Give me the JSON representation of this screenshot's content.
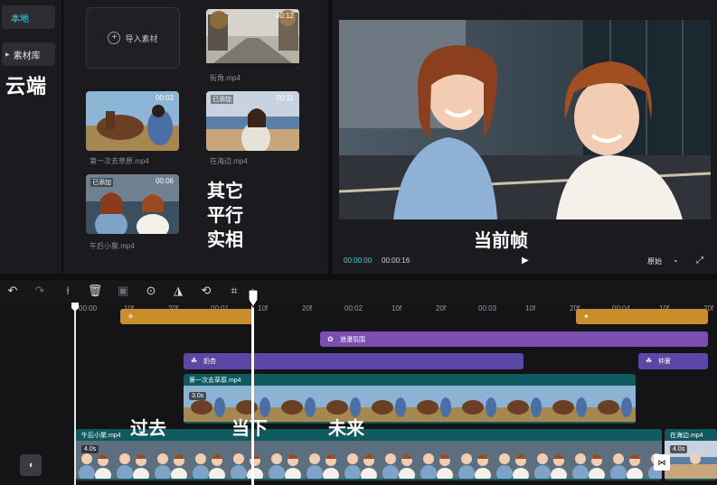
{
  "sidebar": {
    "local_label": "本地",
    "library_label": "素材库",
    "annotation_cloud": "云端"
  },
  "media": {
    "import_label": "导入素材",
    "items": [
      {
        "caption": "街角.mp4",
        "duration": "00:12",
        "badge": ""
      },
      {
        "caption": "第一次去草原.mp4",
        "duration": "00:03",
        "badge": ""
      },
      {
        "caption": "在海边.mp4",
        "duration": "00:11",
        "badge": "已添加"
      },
      {
        "caption": "午后小聚.mp4",
        "duration": "00:06",
        "badge": "已添加"
      }
    ],
    "annotation_lines": [
      "其它",
      "平行",
      "实相"
    ]
  },
  "player": {
    "annotation": "当前帧",
    "current_time": "00:00:00",
    "total_time": "00:00:16",
    "ratio_label": "原始"
  },
  "timeline": {
    "ticks": [
      "00:00",
      "10f",
      "20f",
      "00:01",
      "10f",
      "20f",
      "00:02",
      "10f",
      "20f",
      "00:03",
      "10f",
      "20f",
      "00:04",
      "10f",
      "20f"
    ],
    "tracks": {
      "effect_track_1": {
        "label": "浪漫氛围"
      },
      "filter_a": {
        "label": "奶杏"
      },
      "filter_b": {
        "label": "仲夏"
      },
      "clip_upper": {
        "name": "第一次去草原.mp4",
        "duration": "3.0s"
      },
      "clip_main": {
        "name": "午后小聚.mp4",
        "duration": "4.0s"
      },
      "clip_next": {
        "name": "在海边.mp4",
        "duration": "4.0s"
      }
    },
    "annotations": {
      "past": "过去",
      "now": "当下",
      "future": "未来"
    }
  },
  "colors": {
    "accent": "#3fd6e0",
    "sticker": "#c98d2c",
    "effect": "#7b4fb0",
    "filter": "#5a47a6",
    "video_track": "#0f5a5f"
  }
}
